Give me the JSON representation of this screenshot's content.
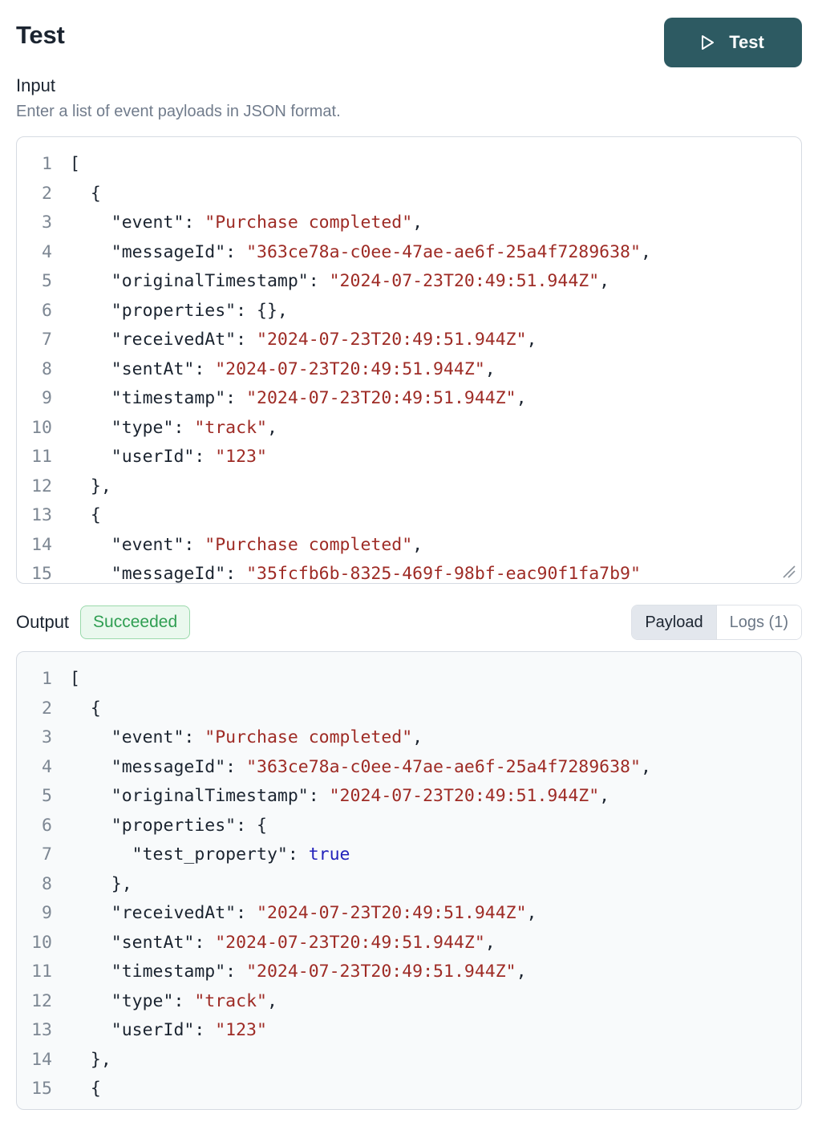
{
  "header": {
    "title": "Test",
    "run_button_label": "Test",
    "run_button_icon": "play-icon",
    "accent_color": "#2d5a62"
  },
  "input": {
    "label": "Input",
    "description": "Enter a list of event payloads in JSON format.",
    "lines": [
      {
        "n": "1",
        "tokens": [
          {
            "t": "[",
            "c": "punct"
          }
        ]
      },
      {
        "n": "2",
        "tokens": [
          {
            "t": "  {",
            "c": "punct"
          }
        ]
      },
      {
        "n": "3",
        "tokens": [
          {
            "t": "    \"event\": ",
            "c": "key"
          },
          {
            "t": "\"Purchase completed\"",
            "c": "str"
          },
          {
            "t": ",",
            "c": "punct"
          }
        ]
      },
      {
        "n": "4",
        "tokens": [
          {
            "t": "    \"messageId\": ",
            "c": "key"
          },
          {
            "t": "\"363ce78a-c0ee-47ae-ae6f-25a4f7289638\"",
            "c": "str"
          },
          {
            "t": ",",
            "c": "punct"
          }
        ]
      },
      {
        "n": "5",
        "tokens": [
          {
            "t": "    \"originalTimestamp\": ",
            "c": "key"
          },
          {
            "t": "\"2024-07-23T20:49:51.944Z\"",
            "c": "str"
          },
          {
            "t": ",",
            "c": "punct"
          }
        ]
      },
      {
        "n": "6",
        "tokens": [
          {
            "t": "    \"properties\": {},",
            "c": "key"
          }
        ]
      },
      {
        "n": "7",
        "tokens": [
          {
            "t": "    \"receivedAt\": ",
            "c": "key"
          },
          {
            "t": "\"2024-07-23T20:49:51.944Z\"",
            "c": "str"
          },
          {
            "t": ",",
            "c": "punct"
          }
        ]
      },
      {
        "n": "8",
        "tokens": [
          {
            "t": "    \"sentAt\": ",
            "c": "key"
          },
          {
            "t": "\"2024-07-23T20:49:51.944Z\"",
            "c": "str"
          },
          {
            "t": ",",
            "c": "punct"
          }
        ]
      },
      {
        "n": "9",
        "tokens": [
          {
            "t": "    \"timestamp\": ",
            "c": "key"
          },
          {
            "t": "\"2024-07-23T20:49:51.944Z\"",
            "c": "str"
          },
          {
            "t": ",",
            "c": "punct"
          }
        ]
      },
      {
        "n": "10",
        "tokens": [
          {
            "t": "    \"type\": ",
            "c": "key"
          },
          {
            "t": "\"track\"",
            "c": "str"
          },
          {
            "t": ",",
            "c": "punct"
          }
        ]
      },
      {
        "n": "11",
        "tokens": [
          {
            "t": "    \"userId\": ",
            "c": "key"
          },
          {
            "t": "\"123\"",
            "c": "str"
          }
        ]
      },
      {
        "n": "12",
        "tokens": [
          {
            "t": "  },",
            "c": "punct"
          }
        ]
      },
      {
        "n": "13",
        "tokens": [
          {
            "t": "  {",
            "c": "punct"
          }
        ]
      },
      {
        "n": "14",
        "tokens": [
          {
            "t": "    \"event\": ",
            "c": "key"
          },
          {
            "t": "\"Purchase completed\"",
            "c": "str"
          },
          {
            "t": ",",
            "c": "punct"
          }
        ]
      },
      {
        "n": "15",
        "tokens": [
          {
            "t": "    \"messageId\": ",
            "c": "key"
          },
          {
            "t": "\"35fcfb6b-8325-469f-98bf-eac90f1fa7b9\"",
            "c": "str"
          }
        ]
      }
    ]
  },
  "output": {
    "label": "Output",
    "status": "Succeeded",
    "status_color": "#2f9e52",
    "tabs": [
      {
        "label": "Payload",
        "active": true
      },
      {
        "label": "Logs (1)",
        "active": false
      }
    ],
    "lines": [
      {
        "n": "1",
        "tokens": [
          {
            "t": "[",
            "c": "punct"
          }
        ]
      },
      {
        "n": "2",
        "tokens": [
          {
            "t": "  {",
            "c": "punct"
          }
        ]
      },
      {
        "n": "3",
        "tokens": [
          {
            "t": "    \"event\": ",
            "c": "key"
          },
          {
            "t": "\"Purchase completed\"",
            "c": "str"
          },
          {
            "t": ",",
            "c": "punct"
          }
        ]
      },
      {
        "n": "4",
        "tokens": [
          {
            "t": "    \"messageId\": ",
            "c": "key"
          },
          {
            "t": "\"363ce78a-c0ee-47ae-ae6f-25a4f7289638\"",
            "c": "str"
          },
          {
            "t": ",",
            "c": "punct"
          }
        ]
      },
      {
        "n": "5",
        "tokens": [
          {
            "t": "    \"originalTimestamp\": ",
            "c": "key"
          },
          {
            "t": "\"2024-07-23T20:49:51.944Z\"",
            "c": "str"
          },
          {
            "t": ",",
            "c": "punct"
          }
        ]
      },
      {
        "n": "6",
        "tokens": [
          {
            "t": "    \"properties\": {",
            "c": "key"
          }
        ]
      },
      {
        "n": "7",
        "tokens": [
          {
            "t": "      \"test_property\": ",
            "c": "key"
          },
          {
            "t": "true",
            "c": "bool"
          }
        ]
      },
      {
        "n": "8",
        "tokens": [
          {
            "t": "    },",
            "c": "punct"
          }
        ]
      },
      {
        "n": "9",
        "tokens": [
          {
            "t": "    \"receivedAt\": ",
            "c": "key"
          },
          {
            "t": "\"2024-07-23T20:49:51.944Z\"",
            "c": "str"
          },
          {
            "t": ",",
            "c": "punct"
          }
        ]
      },
      {
        "n": "10",
        "tokens": [
          {
            "t": "    \"sentAt\": ",
            "c": "key"
          },
          {
            "t": "\"2024-07-23T20:49:51.944Z\"",
            "c": "str"
          },
          {
            "t": ",",
            "c": "punct"
          }
        ]
      },
      {
        "n": "11",
        "tokens": [
          {
            "t": "    \"timestamp\": ",
            "c": "key"
          },
          {
            "t": "\"2024-07-23T20:49:51.944Z\"",
            "c": "str"
          },
          {
            "t": ",",
            "c": "punct"
          }
        ]
      },
      {
        "n": "12",
        "tokens": [
          {
            "t": "    \"type\": ",
            "c": "key"
          },
          {
            "t": "\"track\"",
            "c": "str"
          },
          {
            "t": ",",
            "c": "punct"
          }
        ]
      },
      {
        "n": "13",
        "tokens": [
          {
            "t": "    \"userId\": ",
            "c": "key"
          },
          {
            "t": "\"123\"",
            "c": "str"
          }
        ]
      },
      {
        "n": "14",
        "tokens": [
          {
            "t": "  },",
            "c": "punct"
          }
        ]
      },
      {
        "n": "15",
        "tokens": [
          {
            "t": "  {",
            "c": "punct"
          }
        ]
      }
    ]
  }
}
